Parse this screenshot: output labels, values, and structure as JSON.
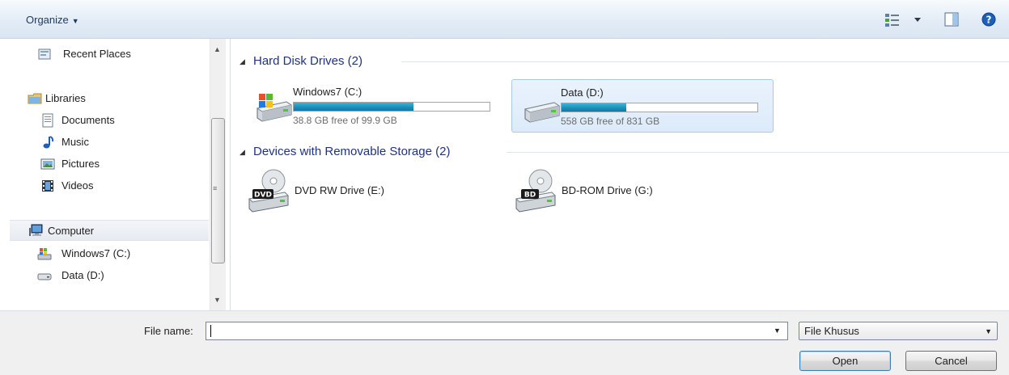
{
  "toolbar": {
    "organize_label": "Organize",
    "icons": [
      "views-icon",
      "views-dropdown-icon",
      "preview-pane-icon",
      "help-icon"
    ]
  },
  "nav": {
    "items": [
      {
        "label": "Recent Places",
        "icon": "recent-places-icon"
      },
      {
        "label": "Libraries",
        "icon": "libraries-icon"
      },
      {
        "label": "Documents",
        "icon": "documents-icon"
      },
      {
        "label": "Music",
        "icon": "music-icon"
      },
      {
        "label": "Pictures",
        "icon": "pictures-icon"
      },
      {
        "label": "Videos",
        "icon": "videos-icon"
      },
      {
        "label": "Computer",
        "icon": "computer-icon"
      },
      {
        "label": "Windows7 (C:)",
        "icon": "windows-drive-icon"
      },
      {
        "label": "Data (D:)",
        "icon": "drive-icon"
      }
    ]
  },
  "content": {
    "groups": [
      {
        "title": "Hard Disk Drives (2)"
      },
      {
        "title": "Devices with Removable Storage (2)"
      }
    ],
    "hard_drives": [
      {
        "name": "Windows7 (C:)",
        "free_text": "38.8 GB free of 99.9 GB",
        "used_fraction": 0.61,
        "selected": false
      },
      {
        "name": "Data (D:)",
        "free_text": "558 GB free of 831 GB",
        "used_fraction": 0.33,
        "selected": true
      }
    ],
    "devices": [
      {
        "name": "DVD RW Drive (E:)",
        "badge": "DVD"
      },
      {
        "name": "BD-ROM Drive (G:)",
        "badge": "BD"
      }
    ]
  },
  "bottom": {
    "file_name_label": "File name:",
    "file_name_value": "",
    "filter_value": "File Khusus",
    "open_label": "Open",
    "cancel_label": "Cancel"
  },
  "colors": {
    "group_title": "#1e3287",
    "bar_fill": "#1a8db8",
    "selection": "#dceafa"
  }
}
